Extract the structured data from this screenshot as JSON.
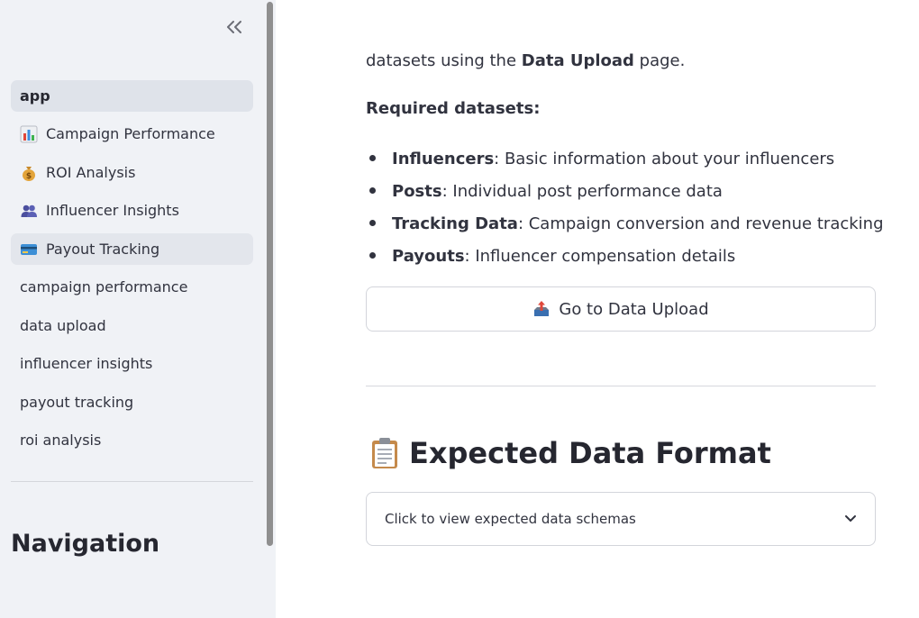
{
  "sidebar": {
    "collapse_icon": "double-chevron-left-icon",
    "items": [
      {
        "label": "app",
        "icon": null,
        "state": "active"
      },
      {
        "label": "Campaign Performance",
        "icon": "bar-chart-icon"
      },
      {
        "label": "ROI Analysis",
        "icon": "money-bag-icon"
      },
      {
        "label": "Influencer Insights",
        "icon": "people-icon"
      },
      {
        "label": "Payout Tracking",
        "icon": "credit-card-icon",
        "state": "hover"
      },
      {
        "label": "campaign performance"
      },
      {
        "label": "data upload"
      },
      {
        "label": "influencer insights"
      },
      {
        "label": "payout tracking"
      },
      {
        "label": "roi analysis"
      }
    ],
    "heading": "Navigation"
  },
  "main": {
    "intro_prefix": "datasets using the ",
    "intro_bold": "Data Upload",
    "intro_suffix": " page.",
    "required_heading": "Required datasets:",
    "datasets": [
      {
        "name": "Influencers",
        "desc": ": Basic information about your influencers"
      },
      {
        "name": "Posts",
        "desc": ": Individual post performance data"
      },
      {
        "name": "Tracking Data",
        "desc": ": Campaign conversion and revenue tracking"
      },
      {
        "name": "Payouts",
        "desc": ": Influencer compensation details"
      }
    ],
    "upload_button": {
      "label": "Go to Data Upload",
      "icon": "outbox-tray-icon"
    },
    "section_title": {
      "label": "Expected Data Format",
      "icon": "clipboard-icon"
    },
    "expander": {
      "label": "Click to view expected data schemas",
      "icon": "chevron-down-icon"
    }
  }
}
